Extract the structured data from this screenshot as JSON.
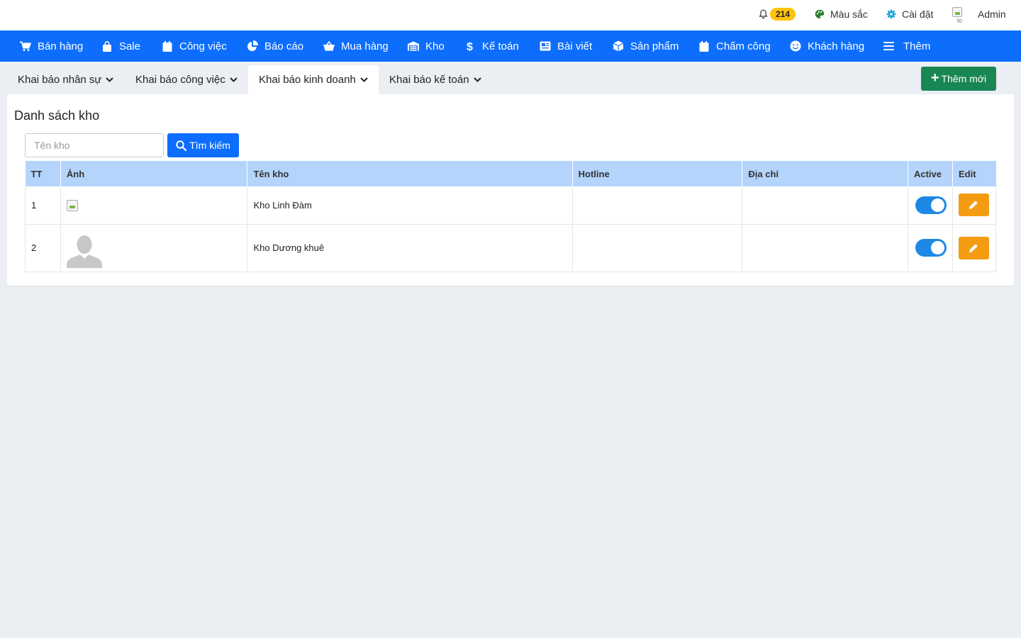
{
  "topbar": {
    "notification_count": "214",
    "color_label": "Màu sắc",
    "settings_label": "Cài đặt",
    "user_avatar_alt": "lo",
    "user_label": "Admin"
  },
  "nav": [
    {
      "label": "Bán hàng",
      "icon": "cart-icon"
    },
    {
      "label": "Sale",
      "icon": "shopping-bag-icon"
    },
    {
      "label": "Công việc",
      "icon": "calendar-icon"
    },
    {
      "label": "Báo cáo",
      "icon": "pie-chart-icon"
    },
    {
      "label": "Mua hàng",
      "icon": "basket-icon"
    },
    {
      "label": "Kho",
      "icon": "warehouse-icon"
    },
    {
      "label": "Kế toán",
      "icon": "dollar-icon"
    },
    {
      "label": "Bài viết",
      "icon": "newspaper-icon"
    },
    {
      "label": "Sản phẩm",
      "icon": "box-icon"
    },
    {
      "label": "Chấm công",
      "icon": "calendar-icon"
    },
    {
      "label": "Khách hàng",
      "icon": "smile-icon"
    },
    {
      "label": "Thêm",
      "icon": "menu-icon"
    }
  ],
  "subtabs": [
    {
      "label": "Khai báo nhân sự"
    },
    {
      "label": "Khai báo công việc"
    },
    {
      "label": "Khai báo kinh doanh"
    },
    {
      "label": "Khai báo kế toán"
    }
  ],
  "add_button": "Thêm mới",
  "panel": {
    "title": "Danh sách kho",
    "search_placeholder": "Tên kho",
    "search_button": "Tìm kiếm"
  },
  "table": {
    "headers": [
      "TT",
      "Ảnh",
      "Tên kho",
      "Hotline",
      "Địa chỉ",
      "Active",
      "Edit"
    ],
    "rows": [
      {
        "tt": "1",
        "name": "Kho Linh Đàm",
        "hotline": "",
        "address": "",
        "active": true
      },
      {
        "tt": "2",
        "name": "Kho Dương khuê",
        "hotline": "",
        "address": "",
        "active": true
      }
    ]
  },
  "colors": {
    "nav_bg": "#0d6efd",
    "add_button_bg": "#198754",
    "table_header_bg": "#b4d4fb",
    "edit_button_bg": "#f39c12",
    "toggle_on": "#1e88e5",
    "badge_bg": "#ffc20e"
  }
}
